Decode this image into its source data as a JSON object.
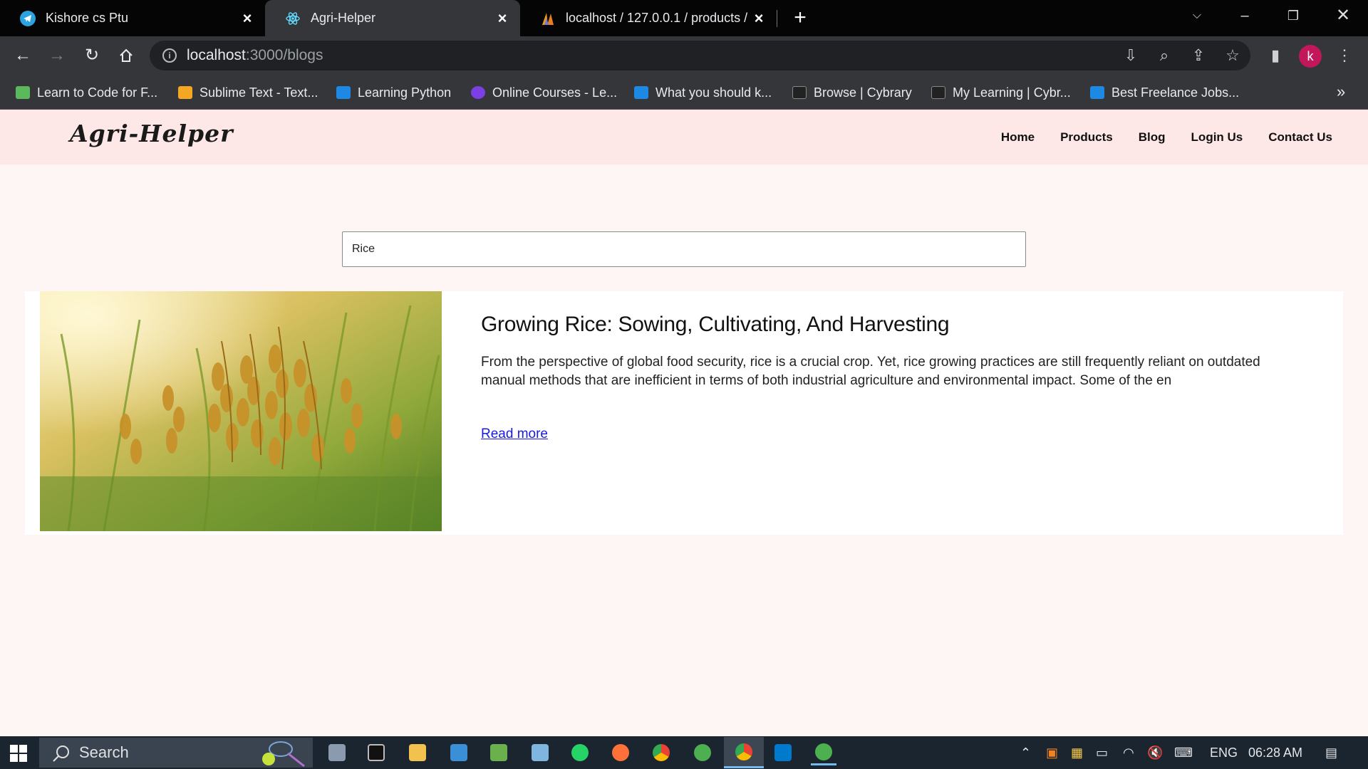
{
  "browser": {
    "tabs": [
      {
        "title": "Kishore cs Ptu",
        "favicon": "telegram-icon"
      },
      {
        "title": "Agri-Helper",
        "favicon": "react-icon"
      },
      {
        "title": "localhost / 127.0.0.1 / products /",
        "favicon": "phpmyadmin-icon"
      }
    ],
    "address": {
      "host": "localhost",
      "path": ":3000/blogs"
    },
    "bookmarks": [
      {
        "label": "Learn to Code for F...",
        "color": "#5cb85c"
      },
      {
        "label": "Sublime Text - Text...",
        "color": "#f5a623"
      },
      {
        "label": "Learning Python",
        "color": "#1e88e5"
      },
      {
        "label": "Online Courses - Le...",
        "color": "#7b3fe4"
      },
      {
        "label": "What you should k...",
        "color": "#1e88e5"
      },
      {
        "label": "Browse | Cybrary",
        "color": "#222222"
      },
      {
        "label": "My Learning | Cybr...",
        "color": "#222222"
      },
      {
        "label": "Best Freelance Jobs...",
        "color": "#1e88e5"
      }
    ],
    "profile_initial": "k"
  },
  "site": {
    "logo": "Agri-Helper",
    "nav": [
      "Home",
      "Products",
      "Blog",
      "Login Us",
      "Contact Us"
    ],
    "search_value": "Rice",
    "blog": {
      "title": "Growing Rice: Sowing, Cultivating, And Harvesting",
      "excerpt": "From the perspective of global food security, rice is a crucial crop. Yet, rice growing practices are still frequently reliant on outdated manual methods that are inefficient in terms of both industrial agriculture and environmental impact. Some of the en",
      "read_more": "Read more"
    }
  },
  "taskbar": {
    "search_placeholder": "Search",
    "language": "ENG",
    "time": "06:28 AM"
  }
}
